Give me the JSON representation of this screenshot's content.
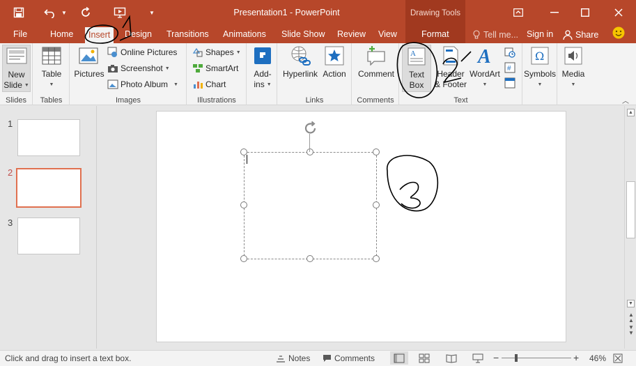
{
  "quick_access": {
    "save_icon": "save-icon",
    "undo_icon": "undo-icon",
    "repeat_icon": "repeat-icon",
    "present_icon": "start-from-beginning-icon",
    "customize_icon": "customize-quick-access-icon"
  },
  "window": {
    "title": "Presentation1 - PowerPoint",
    "context_label": "Drawing Tools"
  },
  "tabs": [
    {
      "label": "File"
    },
    {
      "label": "Home"
    },
    {
      "label": "Insert",
      "active": true
    },
    {
      "label": "Design"
    },
    {
      "label": "Transitions"
    },
    {
      "label": "Animations"
    },
    {
      "label": "Slide Show"
    },
    {
      "label": "Review"
    },
    {
      "label": "View"
    },
    {
      "label": "Format"
    }
  ],
  "tell_me": "Tell me...",
  "sign_in": "Sign in",
  "share": "Share",
  "ribbon": {
    "slides": {
      "label": "Slides",
      "new_slide": "New",
      "new_slide_2": "Slide"
    },
    "tables": {
      "label": "Tables",
      "table": "Table"
    },
    "images": {
      "label": "Images",
      "pictures": "Pictures",
      "online_pictures": "Online Pictures",
      "screenshot": "Screenshot",
      "photo_album": "Photo Album"
    },
    "illustrations": {
      "label": "Illustrations",
      "shapes": "Shapes",
      "smartart": "SmartArt",
      "chart": "Chart"
    },
    "addins": {
      "label_1": "Add-",
      "label_2": "ins"
    },
    "links": {
      "label": "Links",
      "hyperlink": "Hyperlink",
      "action": "Action"
    },
    "comments": {
      "label": "Comments",
      "comment": "Comment"
    },
    "text": {
      "label": "Text",
      "text_box_1": "Text",
      "text_box_2": "Box",
      "header_1": "Header",
      "header_2": "& Footer",
      "wordart": "WordArt"
    },
    "symbols": {
      "label": "Symbols"
    },
    "media": {
      "label": "Media"
    }
  },
  "slides": [
    {
      "number": "1"
    },
    {
      "number": "2",
      "selected": true
    },
    {
      "number": "3"
    }
  ],
  "status": {
    "message": "Click and drag to insert a text box.",
    "notes": "Notes",
    "comments": "Comments",
    "zoom": "46%",
    "zoom_out": "−",
    "zoom_in": "+"
  },
  "annotations": [
    "1",
    "2",
    "3"
  ],
  "colors": {
    "accent": "#b7472a",
    "accent_dark": "#a1391f",
    "selected_thumb": "#e0704f"
  }
}
